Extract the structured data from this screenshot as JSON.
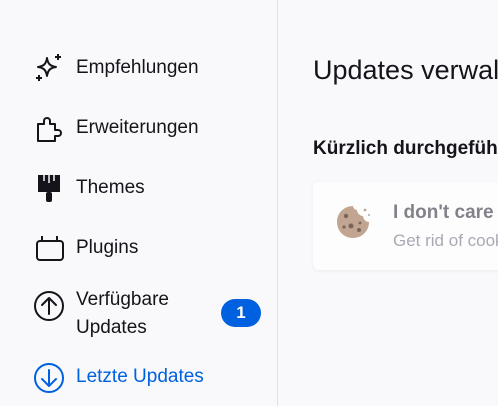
{
  "sidebar": {
    "items": [
      {
        "label": "Empfehlungen",
        "icon": "sparkles-icon"
      },
      {
        "label": "Erweiterungen",
        "icon": "puzzle-icon"
      },
      {
        "label": "Themes",
        "icon": "paintbrush-icon"
      },
      {
        "label": "Plugins",
        "icon": "plugin-icon"
      },
      {
        "label": "Verfügbare Updates",
        "icon": "arrow-up-circle-icon",
        "badge": "1"
      },
      {
        "label": "Letzte Updates",
        "icon": "arrow-down-circle-icon",
        "active": true
      }
    ]
  },
  "main": {
    "title": "Updates verwalten",
    "section_title": "Kürzlich durchgeführte Updates",
    "addon": {
      "name": "I don't care about cookies",
      "description": "Get rid of cookie warnings",
      "icon": "cookie-icon"
    }
  },
  "colors": {
    "accent": "#0061e0",
    "text": "#15141a",
    "background": "#f9f9fb"
  }
}
